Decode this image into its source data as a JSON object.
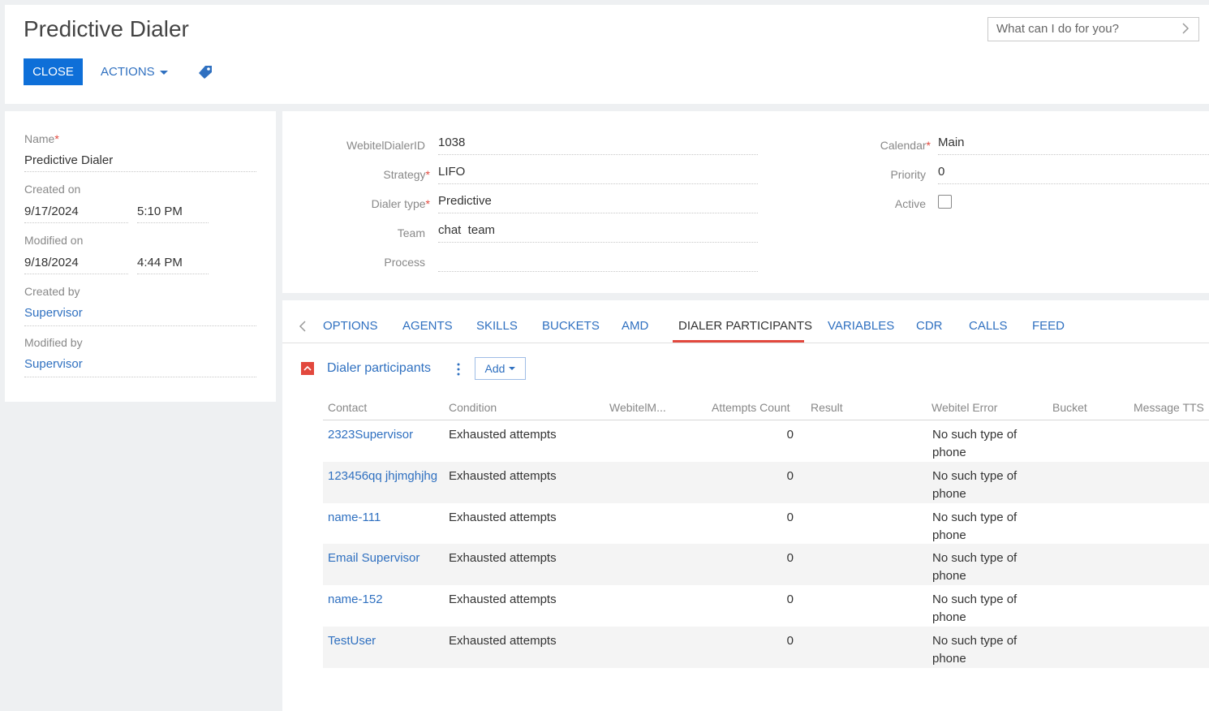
{
  "header": {
    "title": "Predictive Dialer",
    "close_label": "CLOSE",
    "actions_label": "ACTIONS",
    "search_placeholder": "What can I do for you?"
  },
  "left": {
    "name_label": "Name",
    "name_value": "Predictive Dialer",
    "created_on_label": "Created on",
    "created_date": "9/17/2024",
    "created_time": "5:10 PM",
    "modified_on_label": "Modified on",
    "modified_date": "9/18/2024",
    "modified_time": "4:44 PM",
    "created_by_label": "Created by",
    "created_by": "Supervisor",
    "modified_by_label": "Modified by",
    "modified_by": "Supervisor"
  },
  "fields": {
    "dialer_id_label": "WebitelDialerID",
    "dialer_id": "1038",
    "strategy_label": "Strategy",
    "strategy": "LIFO",
    "dialer_type_label": "Dialer type",
    "dialer_type": "Predictive",
    "team_label": "Team",
    "team": "chat  team",
    "process_label": "Process",
    "process": "",
    "calendar_label": "Calendar",
    "calendar": "Main",
    "priority_label": "Priority",
    "priority": "0",
    "active_label": "Active",
    "active": false
  },
  "tabs": [
    "OPTIONS",
    "AGENTS",
    "SKILLS",
    "BUCKETS",
    "AMD",
    "DIALER PARTICIPANTS",
    "VARIABLES",
    "CDR",
    "CALLS",
    "FEED"
  ],
  "active_tab": "DIALER PARTICIPANTS",
  "detail": {
    "title": "Dialer participants",
    "add_label": "Add",
    "columns": [
      "Contact",
      "Condition",
      "WebitelM...",
      "Attempts Count",
      "Result",
      "Webitel Error",
      "Bucket",
      "Message TTS"
    ],
    "rows": [
      {
        "contact": "2323Supervisor",
        "condition": "Exhausted attempts",
        "attempts": "0",
        "error": "No such type of phone"
      },
      {
        "contact": "123456qq jhjmghjhg",
        "condition": "Exhausted attempts",
        "attempts": "0",
        "error": "No such type of phone"
      },
      {
        "contact": "name-111",
        "condition": "Exhausted attempts",
        "attempts": "0",
        "error": "No such type of phone"
      },
      {
        "contact": "Email Supervisor",
        "condition": "Exhausted attempts",
        "attempts": "0",
        "error": "No such type of phone"
      },
      {
        "contact": "name-152",
        "condition": "Exhausted attempts",
        "attempts": "0",
        "error": "No such type of phone"
      },
      {
        "contact": "TestUser",
        "condition": "Exhausted attempts",
        "attempts": "0",
        "error": "No such type of phone"
      }
    ]
  },
  "colors": {
    "primary": "#0e6fd8",
    "link": "#2f70c0",
    "required": "#e2483d",
    "tab_underline": "#e2483d"
  }
}
